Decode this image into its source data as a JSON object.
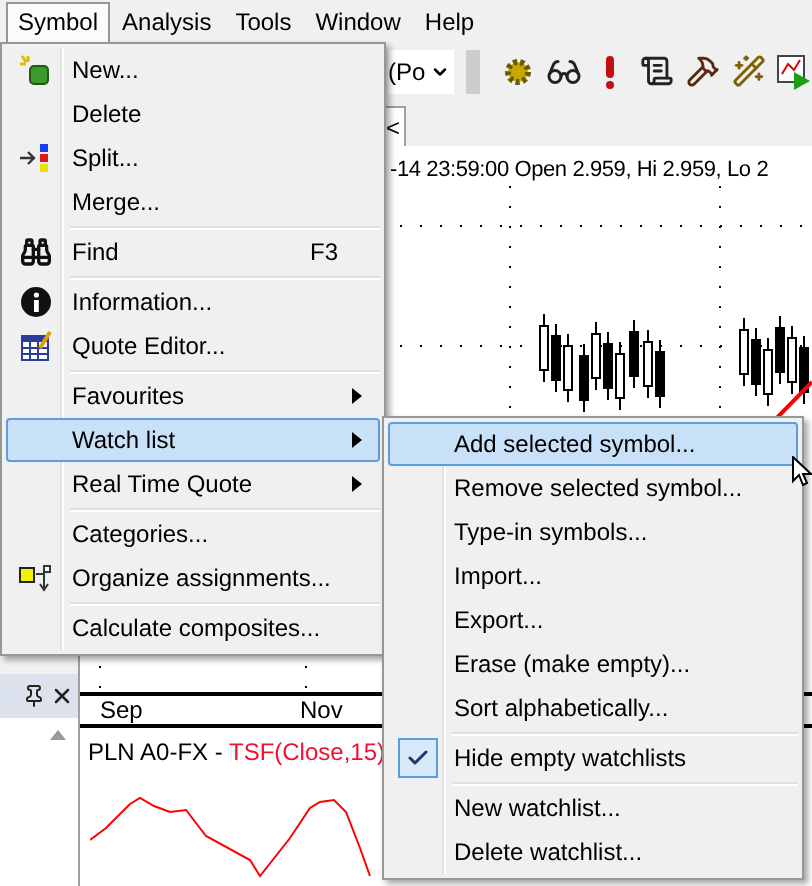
{
  "menubar": [
    {
      "label": "Symbol",
      "selected": true
    },
    {
      "label": "Analysis",
      "selected": false
    },
    {
      "label": "Tools",
      "selected": false
    },
    {
      "label": "Window",
      "selected": false
    },
    {
      "label": "Help",
      "selected": false
    }
  ],
  "toolbar": {
    "combo_value": "(Po"
  },
  "chart": {
    "tab_label": "<",
    "header": "-14 23:59:00 Open 2.959, Hi 2.959, Lo 2",
    "x_axis": [
      "Sep",
      "Nov"
    ]
  },
  "indicator_pane": {
    "symbol": "PLN A0-FX - ",
    "formula": "TSF(Close,15)"
  },
  "symbol_menu": [
    {
      "kind": "item",
      "label": "New...",
      "selected": false,
      "submenu": false
    },
    {
      "kind": "item",
      "label": "Delete",
      "selected": false,
      "submenu": false
    },
    {
      "kind": "item",
      "label": "Split...",
      "selected": false,
      "submenu": false
    },
    {
      "kind": "item",
      "label": "Merge...",
      "selected": false,
      "submenu": false
    },
    {
      "kind": "separator"
    },
    {
      "kind": "item",
      "label": "Find",
      "shortcut": "F3",
      "selected": false,
      "submenu": false
    },
    {
      "kind": "separator"
    },
    {
      "kind": "item",
      "label": "Information...",
      "selected": false,
      "submenu": false
    },
    {
      "kind": "item",
      "label": "Quote Editor...",
      "selected": false,
      "submenu": false
    },
    {
      "kind": "separator"
    },
    {
      "kind": "item",
      "label": "Favourites",
      "selected": false,
      "submenu": true
    },
    {
      "kind": "item",
      "label": "Watch list",
      "selected": true,
      "submenu": true
    },
    {
      "kind": "item",
      "label": "Real Time Quote",
      "selected": false,
      "submenu": true
    },
    {
      "kind": "separator"
    },
    {
      "kind": "item",
      "label": "Categories...",
      "selected": false,
      "submenu": false
    },
    {
      "kind": "item",
      "label": "Organize assignments...",
      "selected": false,
      "submenu": false
    },
    {
      "kind": "separator"
    },
    {
      "kind": "item",
      "label": "Calculate composites...",
      "selected": false,
      "submenu": false
    }
  ],
  "watch_list_menu": [
    {
      "kind": "item",
      "label": "Add selected symbol...",
      "selected": true,
      "checked": false
    },
    {
      "kind": "item",
      "label": "Remove selected symbol...",
      "selected": false,
      "checked": false
    },
    {
      "kind": "item",
      "label": "Type-in symbols...",
      "selected": false,
      "checked": false
    },
    {
      "kind": "item",
      "label": "Import...",
      "selected": false,
      "checked": false
    },
    {
      "kind": "item",
      "label": "Export...",
      "selected": false,
      "checked": false
    },
    {
      "kind": "item",
      "label": "Erase (make empty)...",
      "selected": false,
      "checked": false
    },
    {
      "kind": "item",
      "label": "Sort alphabetically...",
      "selected": false,
      "checked": false
    },
    {
      "kind": "separator"
    },
    {
      "kind": "item",
      "label": "Hide empty watchlists",
      "selected": false,
      "checked": true
    },
    {
      "kind": "separator"
    },
    {
      "kind": "item",
      "label": "New watchlist...",
      "selected": false,
      "checked": false
    },
    {
      "kind": "item",
      "label": "Delete watchlist...",
      "selected": false,
      "checked": false
    }
  ]
}
